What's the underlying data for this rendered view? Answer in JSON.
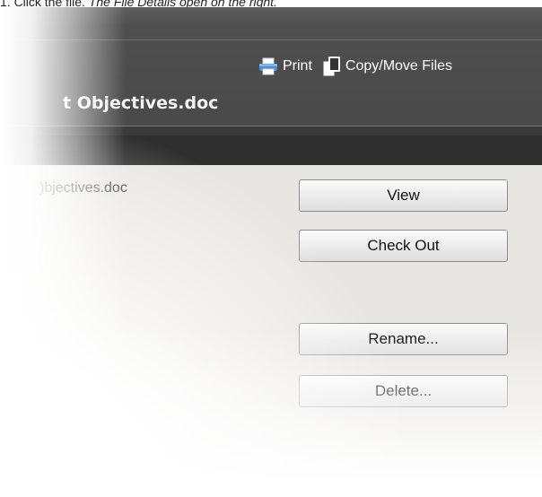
{
  "instruction": {
    "prefix": "1. Click the file. ",
    "italic": "The File Details open on the right."
  },
  "toolbar": {
    "print_label": "Print",
    "copy_move_label": "Copy/Move Files",
    "print_icon": "printer-icon",
    "copy_icon": "copy-icon"
  },
  "file": {
    "title": "t Objectives.doc",
    "name": ")bjectives.doc"
  },
  "actions": {
    "view": "View",
    "check_out": "Check Out",
    "rename": "Rename...",
    "delete": "Delete..."
  },
  "colors": {
    "header_bg": "#474747",
    "panel_bg": "#e8e6e3",
    "button_border": "#8f8f8f"
  }
}
